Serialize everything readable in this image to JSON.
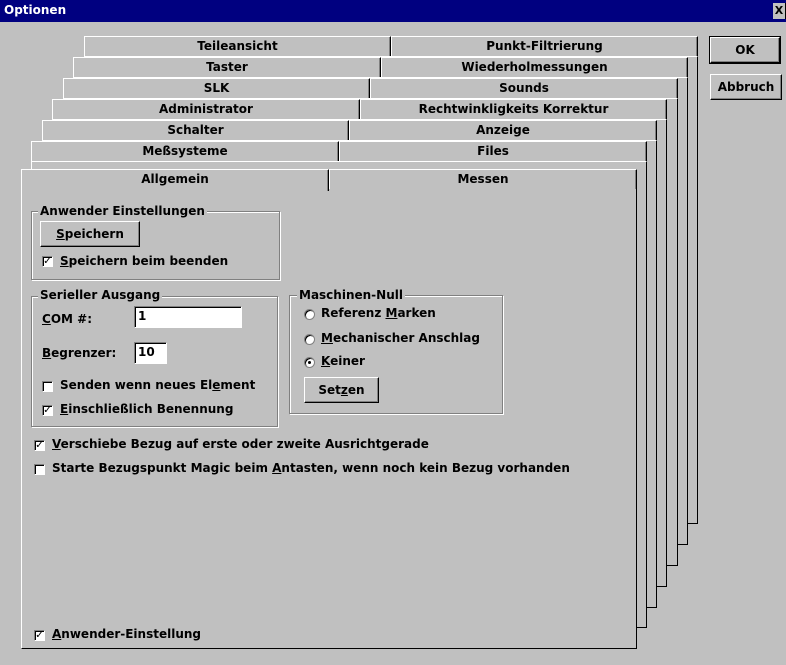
{
  "window": {
    "title": "Optionen",
    "close_glyph": "X"
  },
  "buttons": {
    "ok": "OK",
    "cancel": "Abbruch"
  },
  "tabs": [
    {
      "left": "Teileansicht",
      "right": "Punkt-Filtrierung"
    },
    {
      "left": "Taster",
      "right": "Wiederholmessungen"
    },
    {
      "left": "SLK",
      "right": "Sounds"
    },
    {
      "left": "Administrator",
      "right": "Rechtwinkligkeits Korrektur"
    },
    {
      "left": "Schalter",
      "right": "Anzeige"
    },
    {
      "left": "Meßsysteme",
      "right": "Files"
    },
    {
      "left": "Allgemein",
      "right": "Messen"
    }
  ],
  "anwender": {
    "title": "Anwender Einstellungen",
    "save_button": {
      "pre": "",
      "key": "S",
      "post": "peichern"
    },
    "save_on_exit": {
      "pre": "",
      "key": "S",
      "post": "peichern beim beenden",
      "checked": true
    }
  },
  "seriell": {
    "title": "Serieller Ausgang",
    "com_label": {
      "pre": "",
      "key": "C",
      "post": "OM #:"
    },
    "com_value": "1",
    "limiter_label": {
      "pre": "",
      "key": "B",
      "post": "egrenzer:"
    },
    "limiter_value": "10",
    "send_new": {
      "pre": "Senden wenn neues El",
      "key": "e",
      "post": "ment",
      "checked": false
    },
    "include_name": {
      "pre": "",
      "key": "E",
      "post": "inschließlich Benennung",
      "checked": true
    }
  },
  "maschinen": {
    "title": "Maschinen-Null",
    "options": [
      {
        "pre": "Referenz ",
        "key": "M",
        "post": "arken",
        "selected": false
      },
      {
        "pre": "",
        "key": "M",
        "post": "echanischer Anschlag",
        "selected": false
      },
      {
        "pre": "",
        "key": "K",
        "post": "einer",
        "selected": true
      }
    ],
    "set_button": {
      "pre": "Set",
      "key": "z",
      "post": "en"
    }
  },
  "options": {
    "shift_ref": {
      "pre": "",
      "key": "V",
      "post": "erschiebe Bezug auf erste oder zweite Ausrichtgerade",
      "checked": true
    },
    "start_magic": {
      "pre": "Starte Bezugspunkt Magic beim ",
      "key": "A",
      "post": "ntasten, wenn noch kein Bezug vorhanden",
      "checked": false
    },
    "user_setting": {
      "pre": "",
      "key": "A",
      "post": "nwender-Einstellung",
      "checked": true
    }
  }
}
